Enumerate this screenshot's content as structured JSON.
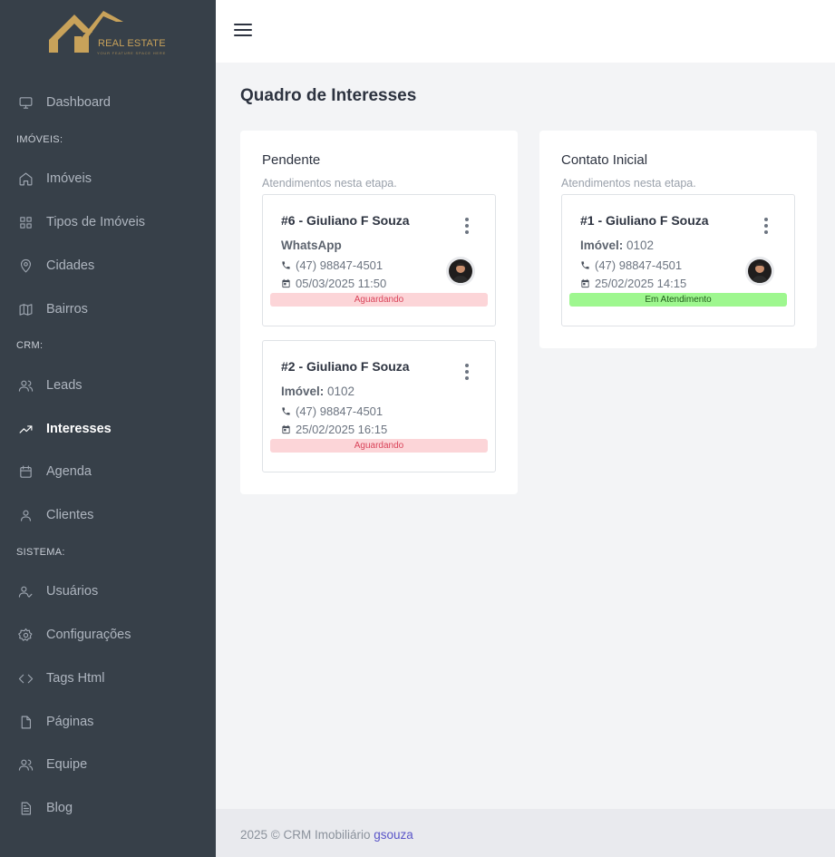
{
  "brand": {
    "name": "REAL ESTATE",
    "tagline": "YOUR FEATURE SPACE HERE",
    "gold": "#c8a25a"
  },
  "sidebar": {
    "items": [
      {
        "label": "Dashboard",
        "icon": "monitor-icon"
      },
      {
        "label": "Imóveis",
        "icon": "home-icon"
      },
      {
        "label": "Tipos de Imóveis",
        "icon": "grid-icon"
      },
      {
        "label": "Cidades",
        "icon": "map-pin-icon"
      },
      {
        "label": "Bairros",
        "icon": "map-icon"
      },
      {
        "label": "Leads",
        "icon": "users-icon"
      },
      {
        "label": "Interesses",
        "icon": "trending-up-icon"
      },
      {
        "label": "Agenda",
        "icon": "calendar-icon"
      },
      {
        "label": "Clientes",
        "icon": "user-icon"
      },
      {
        "label": "Usuários",
        "icon": "user-check-icon"
      },
      {
        "label": "Configurações",
        "icon": "gear-icon"
      },
      {
        "label": "Tags Html",
        "icon": "code-icon"
      },
      {
        "label": "Páginas",
        "icon": "file-icon"
      },
      {
        "label": "Equipe",
        "icon": "team-icon"
      },
      {
        "label": "Blog",
        "icon": "document-icon"
      }
    ],
    "sections": [
      "IMÓVEIS:",
      "CRM:",
      "SISTEMA:"
    ],
    "active": "Interesses"
  },
  "main": {
    "title": "Quadro de Interesses",
    "columns": [
      {
        "title": "Pendente",
        "subtitle": "Atendimentos nesta etapa.",
        "cards": [
          {
            "title": "#6 - Giuliano F Souza",
            "line1_label": "",
            "line1_value": "WhatsApp",
            "phone": "(47) 98847-4501",
            "date": "05/03/2025 11:50",
            "status": "Aguardando",
            "status_type": "pending",
            "has_avatar": true
          },
          {
            "title": "#2 - Giuliano F Souza",
            "line1_label": "Imóvel:",
            "line1_value": " 0102",
            "phone": "(47) 98847-4501",
            "date": "25/02/2025 16:15",
            "status": "Aguardando",
            "status_type": "pending",
            "has_avatar": false
          }
        ]
      },
      {
        "title": "Contato Inicial",
        "subtitle": "Atendimentos nesta etapa.",
        "cards": [
          {
            "title": "#1 - Giuliano F Souza",
            "line1_label": "Imóvel:",
            "line1_value": " 0102",
            "phone": "(47) 98847-4501",
            "date": "25/02/2025 14:15",
            "status": "Em Atendimento",
            "status_type": "progress",
            "has_avatar": true
          }
        ]
      }
    ]
  },
  "footer": {
    "text": "2025 © CRM Imobiliário ",
    "link": "gsouza"
  }
}
